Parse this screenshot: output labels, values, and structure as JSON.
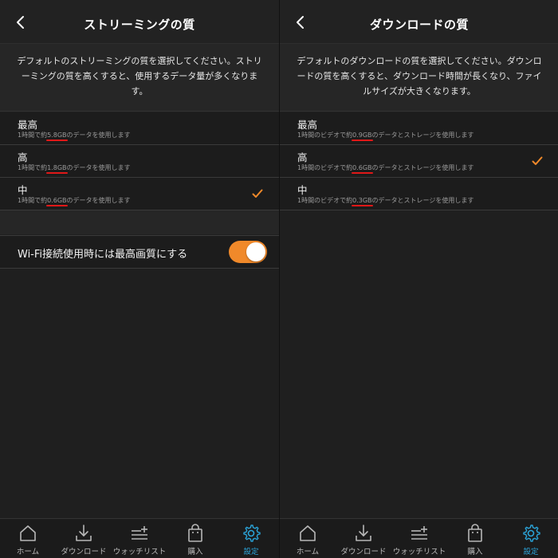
{
  "colors": {
    "accent_orange": "#f0892a",
    "accent_blue": "#2aa3d8",
    "highlight_red": "#e01818"
  },
  "left": {
    "title": "ストリーミングの質",
    "description": "デフォルトのストリーミングの質を選択してください。ストリーミングの質を高くすると、使用するデータ量が多くなります。",
    "options": [
      {
        "label": "最高",
        "pre": "1時間で約",
        "value": "5.8GB",
        "post": "のデータを使用します",
        "selected": false
      },
      {
        "label": "高",
        "pre": "1時間で約",
        "value": "1.8GB",
        "post": "のデータを使用します",
        "selected": false
      },
      {
        "label": "中",
        "pre": "1時間で約",
        "value": "0.6GB",
        "post": "のデータを使用します",
        "selected": true
      }
    ],
    "wifi_label": "Wi-Fi接続使用時には最高画質にする",
    "wifi_on": true
  },
  "right": {
    "title": "ダウンロードの質",
    "description": "デフォルトのダウンロードの質を選択してください。ダウンロードの質を高くすると、ダウンロード時間が長くなり、ファイルサイズが大きくなります。",
    "options": [
      {
        "label": "最高",
        "pre": "1時間のビデオで約",
        "value": "0.9GB",
        "post": "のデータとストレージを使用します",
        "selected": false
      },
      {
        "label": "高",
        "pre": "1時間のビデオで約",
        "value": "0.6GB",
        "post": "のデータとストレージを使用します",
        "selected": true
      },
      {
        "label": "中",
        "pre": "1時間のビデオで約",
        "value": "0.3GB",
        "post": "のデータとストレージを使用します",
        "selected": false
      }
    ]
  },
  "tabs": [
    {
      "label": "ホーム",
      "icon": "home-icon"
    },
    {
      "label": "ダウンロード",
      "icon": "download-icon"
    },
    {
      "label": "ウォッチリスト",
      "icon": "watchlist-icon"
    },
    {
      "label": "購入",
      "icon": "bag-icon"
    },
    {
      "label": "設定",
      "icon": "gear-icon",
      "active": true
    }
  ]
}
